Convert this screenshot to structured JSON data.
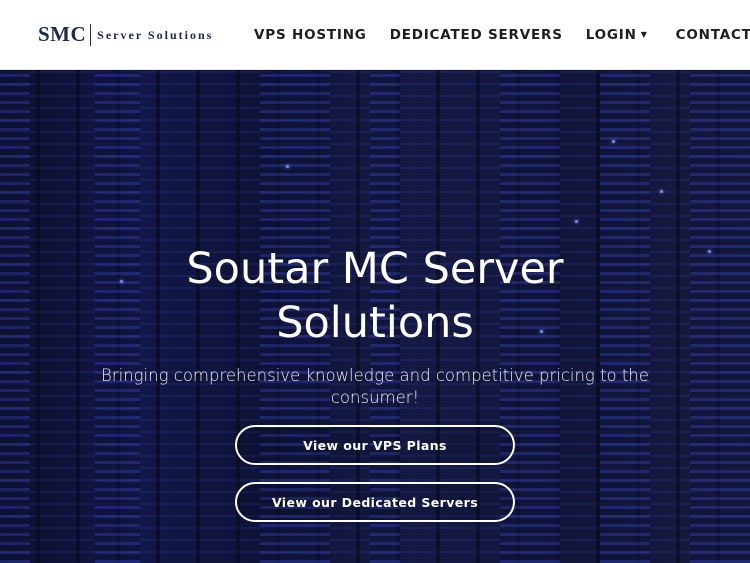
{
  "brand": {
    "logo": "SMC",
    "tagline": "Server Solutions"
  },
  "nav": {
    "items": [
      {
        "label": "VPS HOSTING"
      },
      {
        "label": "DEDICATED SERVERS"
      },
      {
        "label": "LOGIN",
        "has_dropdown": true
      },
      {
        "label": "CONTACT US"
      }
    ],
    "dropdown_icon": "caret-down-icon"
  },
  "hero": {
    "title_line1": "Soutar MC Server",
    "title_line2": "Solutions",
    "subtitle": "Bringing comprehensive knowledge and competitive pricing to the consumer!",
    "buttons": [
      {
        "label": "View our VPS Plans"
      },
      {
        "label": "View our Dedicated Servers"
      }
    ]
  },
  "colors": {
    "brand": "#1d2a4d",
    "hero_overlay": "#0a0e28",
    "button_border": "#ffffff"
  }
}
